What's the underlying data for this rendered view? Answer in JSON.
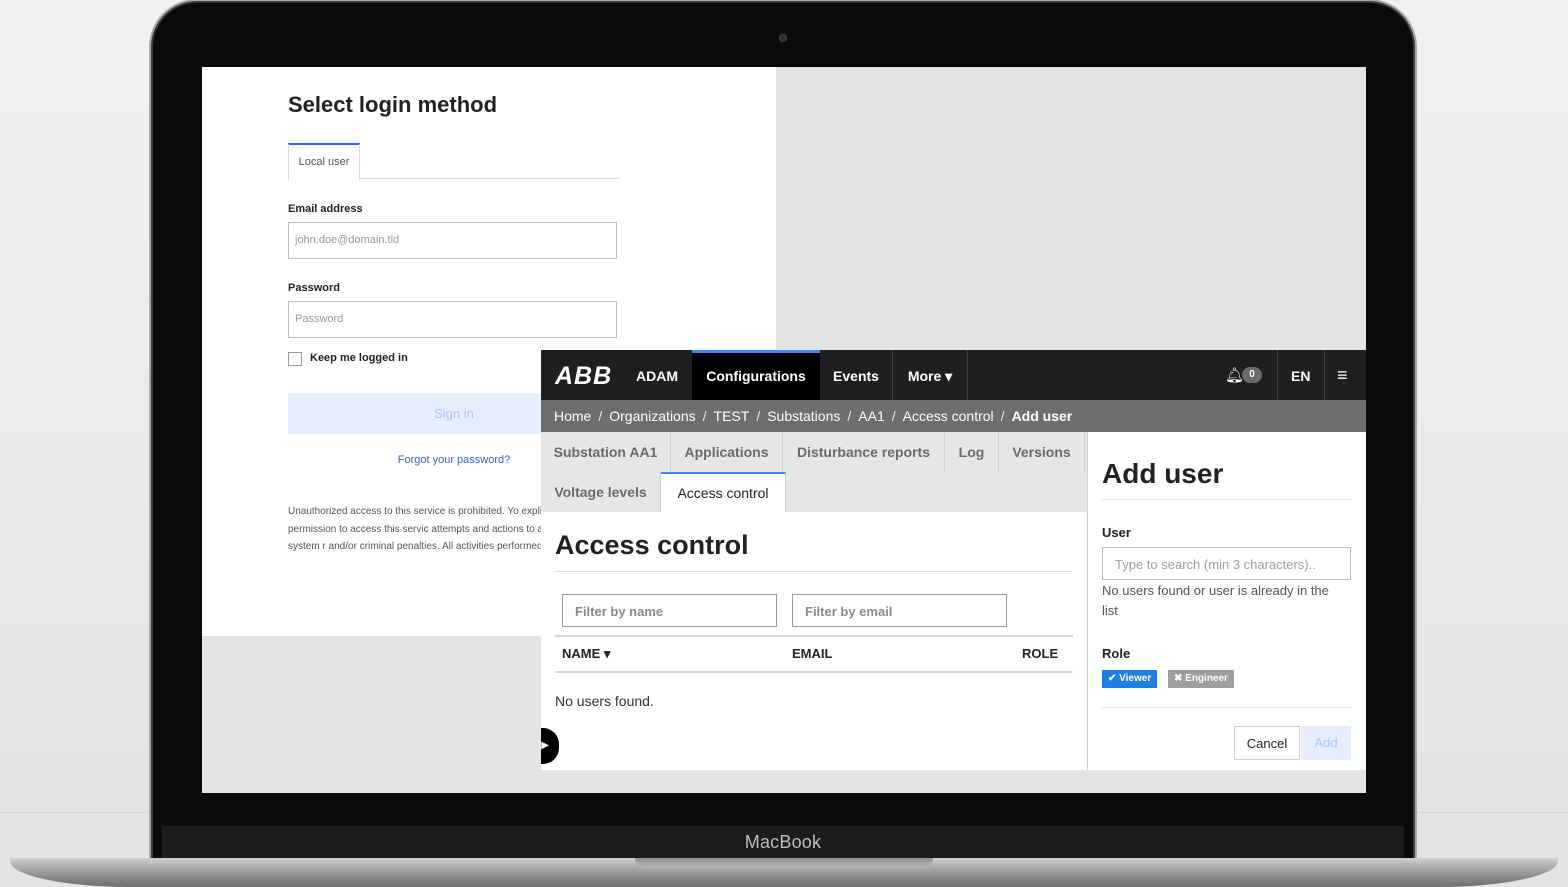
{
  "device": {
    "brand": "MacBook"
  },
  "login": {
    "title": "Select login method",
    "tab_local": "Local user",
    "email_label": "Email address",
    "email_placeholder": "john.doe@domain.tld",
    "password_label": "Password",
    "password_placeholder": "Password",
    "keep_logged_in": "Keep me logged in",
    "sign_in": "Sign in",
    "forgot": "Forgot your password?",
    "notice": "Unauthorized access to this service is prohibited. Yo explicit, authorized permission to access this servic attempts and actions to access or use this system r and/or criminal penalties. All activities performed o logged."
  },
  "app": {
    "logo": "ABB",
    "nav": [
      "ADAM",
      "Configurations",
      "Events",
      "More ▾"
    ],
    "notifications": "0",
    "language": "EN",
    "menu_icon": "≡",
    "breadcrumb": [
      "Home",
      "Organizations",
      "TEST",
      "Substations",
      "AA1",
      "Access control",
      "Add user"
    ],
    "subtabs_row1": [
      "Substation AA1",
      "Applications",
      "Disturbance reports",
      "Log",
      "Versions"
    ],
    "subtabs_row2": [
      "Voltage levels",
      "Access control"
    ],
    "main_title": "Access control",
    "filter_name_placeholder": "Filter by name",
    "filter_email_placeholder": "Filter by email",
    "columns": [
      "NAME ▾",
      "EMAIL",
      "ROLE"
    ],
    "empty_message": "No users found."
  },
  "add_user": {
    "title": "Add user",
    "user_label": "User",
    "search_placeholder": "Type to search (min 3 characters)..",
    "hint": "No users found or user is already in the list",
    "role_label": "Role",
    "roles": [
      {
        "label": "✔ Viewer",
        "selected": true
      },
      {
        "label": "✖ Engineer",
        "selected": false
      }
    ],
    "cancel": "Cancel",
    "add": "Add"
  },
  "colors": {
    "accent": "#3f86ff",
    "topbar": "#1f1f1f",
    "breadcrumb_bar": "#6e6e6e",
    "role_selected": "#1f7fe0",
    "role_unselected": "#9e9e9e"
  }
}
